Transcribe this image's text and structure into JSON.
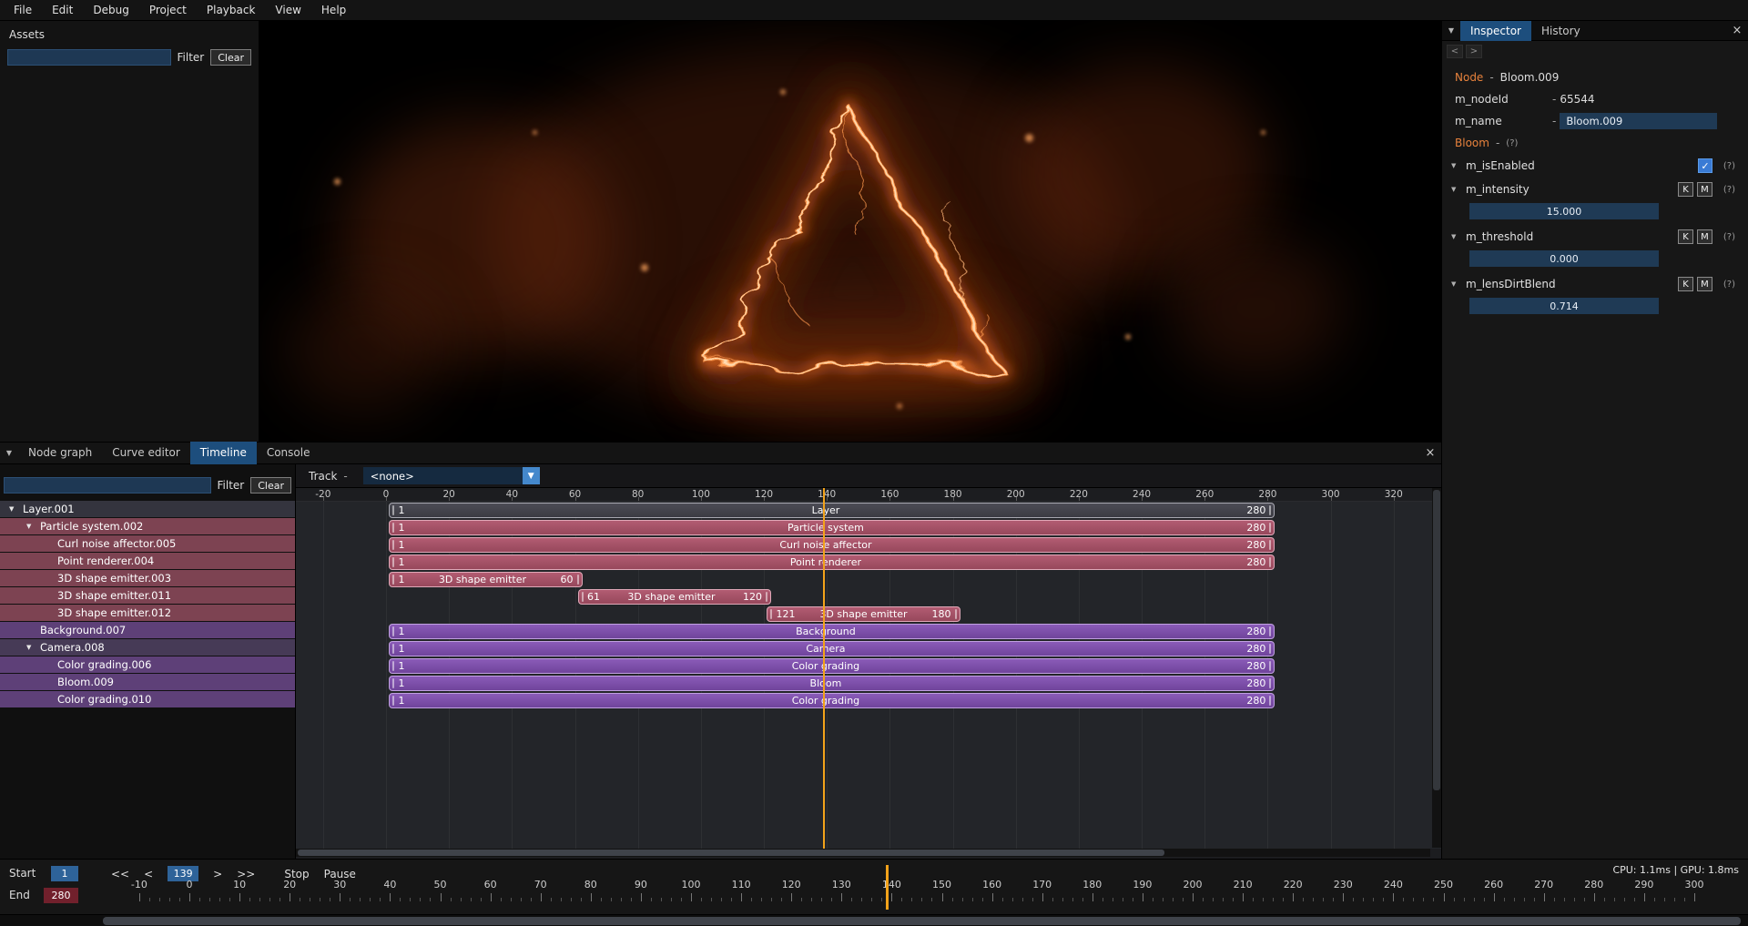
{
  "menu": {
    "items": [
      "File",
      "Edit",
      "Debug",
      "Project",
      "Playback",
      "View",
      "Help"
    ]
  },
  "assets_panel": {
    "title": "Assets",
    "filter_value": "",
    "filter_button": "Filter",
    "clear_button": "Clear"
  },
  "inspector": {
    "tabs": [
      {
        "label": "Inspector"
      },
      {
        "label": "History"
      }
    ],
    "close_icon": "×",
    "nav_back": "<",
    "nav_forward": ">",
    "node": {
      "label": "Node",
      "dash": "-",
      "value": "Bloom.009"
    },
    "node_id": {
      "label": "m_nodeId",
      "dash": "-",
      "value": "65544"
    },
    "name": {
      "label": "m_name",
      "dash": "-",
      "value": "Bloom.009"
    },
    "component": {
      "label": "Bloom",
      "dash": "-",
      "help": "(?)"
    },
    "properties": [
      {
        "name": "m_isEnabled",
        "type": "checkbox",
        "checked": true,
        "help": "(?)"
      },
      {
        "name": "m_intensity",
        "type": "number",
        "value": "15.000",
        "key_button": "K",
        "curve_button": "M",
        "help": "(?)"
      },
      {
        "name": "m_threshold",
        "type": "number",
        "value": "0.000",
        "key_button": "K",
        "curve_button": "M",
        "help": "(?)"
      },
      {
        "name": "m_lensDirtBlend",
        "type": "number",
        "value": "0.714",
        "key_button": "K",
        "curve_button": "M",
        "help": "(?)"
      }
    ]
  },
  "bottom_tabs": {
    "tabs": [
      {
        "label": "Node graph",
        "active": false
      },
      {
        "label": "Curve editor",
        "active": false
      },
      {
        "label": "Timeline",
        "active": true
      },
      {
        "label": "Console",
        "active": false
      }
    ],
    "close_icon": "×"
  },
  "timeline": {
    "filter_value": "",
    "filter_button": "Filter",
    "clear_button": "Clear",
    "track_label": "Track",
    "track_dash": "-",
    "track_selector_value": "<none>",
    "dropdown_icon": "▼",
    "ruler": {
      "start": -20,
      "end": 320,
      "step": 20
    },
    "playhead_frame": 139,
    "tree": [
      {
        "label": "Layer.001",
        "indent": 0,
        "expanded": true,
        "color": "gray"
      },
      {
        "label": "Particle system.002",
        "indent": 1,
        "expanded": true,
        "color": "red"
      },
      {
        "label": "Curl noise affector.005",
        "indent": 2,
        "expanded": false,
        "color": "red"
      },
      {
        "label": "Point renderer.004",
        "indent": 2,
        "expanded": false,
        "color": "red"
      },
      {
        "label": "3D shape emitter.003",
        "indent": 2,
        "expanded": false,
        "color": "red"
      },
      {
        "label": "3D shape emitter.011",
        "indent": 2,
        "expanded": false,
        "color": "red"
      },
      {
        "label": "3D shape emitter.012",
        "indent": 2,
        "expanded": false,
        "color": "red"
      },
      {
        "label": "Background.007",
        "indent": 1,
        "expanded": false,
        "color": "purple"
      },
      {
        "label": "Camera.008",
        "indent": 1,
        "expanded": true,
        "color": "darkpurple"
      },
      {
        "label": "Color grading.006",
        "indent": 2,
        "expanded": false,
        "color": "purple"
      },
      {
        "label": "Bloom.009",
        "indent": 2,
        "expanded": false,
        "color": "purple"
      },
      {
        "label": "Color grading.010",
        "indent": 2,
        "expanded": false,
        "color": "purple"
      }
    ],
    "tracks": [
      {
        "label": "Layer",
        "start": 1,
        "end": 280,
        "color": "gray"
      },
      {
        "label": "Particle system",
        "start": 1,
        "end": 280,
        "color": "red"
      },
      {
        "label": "Curl noise affector",
        "start": 1,
        "end": 280,
        "color": "red"
      },
      {
        "label": "Point renderer",
        "start": 1,
        "end": 280,
        "color": "red"
      },
      {
        "label": "3D shape emitter",
        "start": 1,
        "end": 60,
        "color": "red"
      },
      {
        "label": "3D shape emitter",
        "start": 61,
        "end": 120,
        "color": "red"
      },
      {
        "label": "3D shape emitter",
        "start": 121,
        "end": 180,
        "color": "red"
      },
      {
        "label": "Background",
        "start": 1,
        "end": 280,
        "color": "purple"
      },
      {
        "label": "Camera",
        "start": 1,
        "end": 280,
        "color": "purple"
      },
      {
        "label": "Color grading",
        "start": 1,
        "end": 280,
        "color": "purple"
      },
      {
        "label": "Bloom",
        "start": 1,
        "end": 280,
        "color": "purple"
      },
      {
        "label": "Color grading",
        "start": 1,
        "end": 280,
        "color": "purple"
      }
    ]
  },
  "transport": {
    "start_label": "Start",
    "start_value": "1",
    "end_label": "End",
    "end_value": "280",
    "rewind_button": "<<",
    "prev_button": "<",
    "frame_value": "139",
    "next_button": ">",
    "forward_button": ">>",
    "stop_button": "Stop",
    "pause_button": "Pause",
    "ruler": {
      "start": -10,
      "end": 300,
      "step": 10
    },
    "playhead_frame": 139,
    "stats": "CPU: 1.1ms | GPU: 1.8ms"
  },
  "colors": {
    "accent_orange": "#e8823c",
    "playhead_orange": "#f2a21a",
    "field_blue": "#1f3a55",
    "frame_field_blue": "#2e6399",
    "end_field_red": "#71202c",
    "selected_tab_blue": "#1d4e7d",
    "checkbox_blue": "#3a7bd5",
    "bar_red": "#a8546a",
    "bar_purple": "#7e50ab",
    "bar_gray": "#45454e",
    "tree_red": "#7d4352",
    "tree_purple": "#5e4078"
  }
}
